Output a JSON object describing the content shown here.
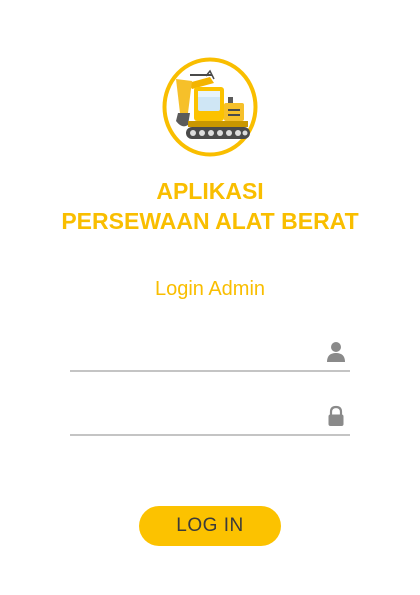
{
  "app": {
    "title_line1": "APLIKASI",
    "title_line2": "PERSEWAAN ALAT BERAT",
    "subtitle": "Login Admin"
  },
  "logo": {
    "icon": "excavator-icon"
  },
  "form": {
    "username": {
      "value": "",
      "placeholder": "",
      "icon": "person-icon"
    },
    "password": {
      "value": "",
      "placeholder": "",
      "icon": "lock-icon"
    },
    "login_label": "LOG IN"
  },
  "colors": {
    "accent": "#f9be00",
    "button": "#fcc200",
    "button_text": "#3b3b3b",
    "underline": "#c4c4c4",
    "icon_gray": "#8a8a8a"
  }
}
